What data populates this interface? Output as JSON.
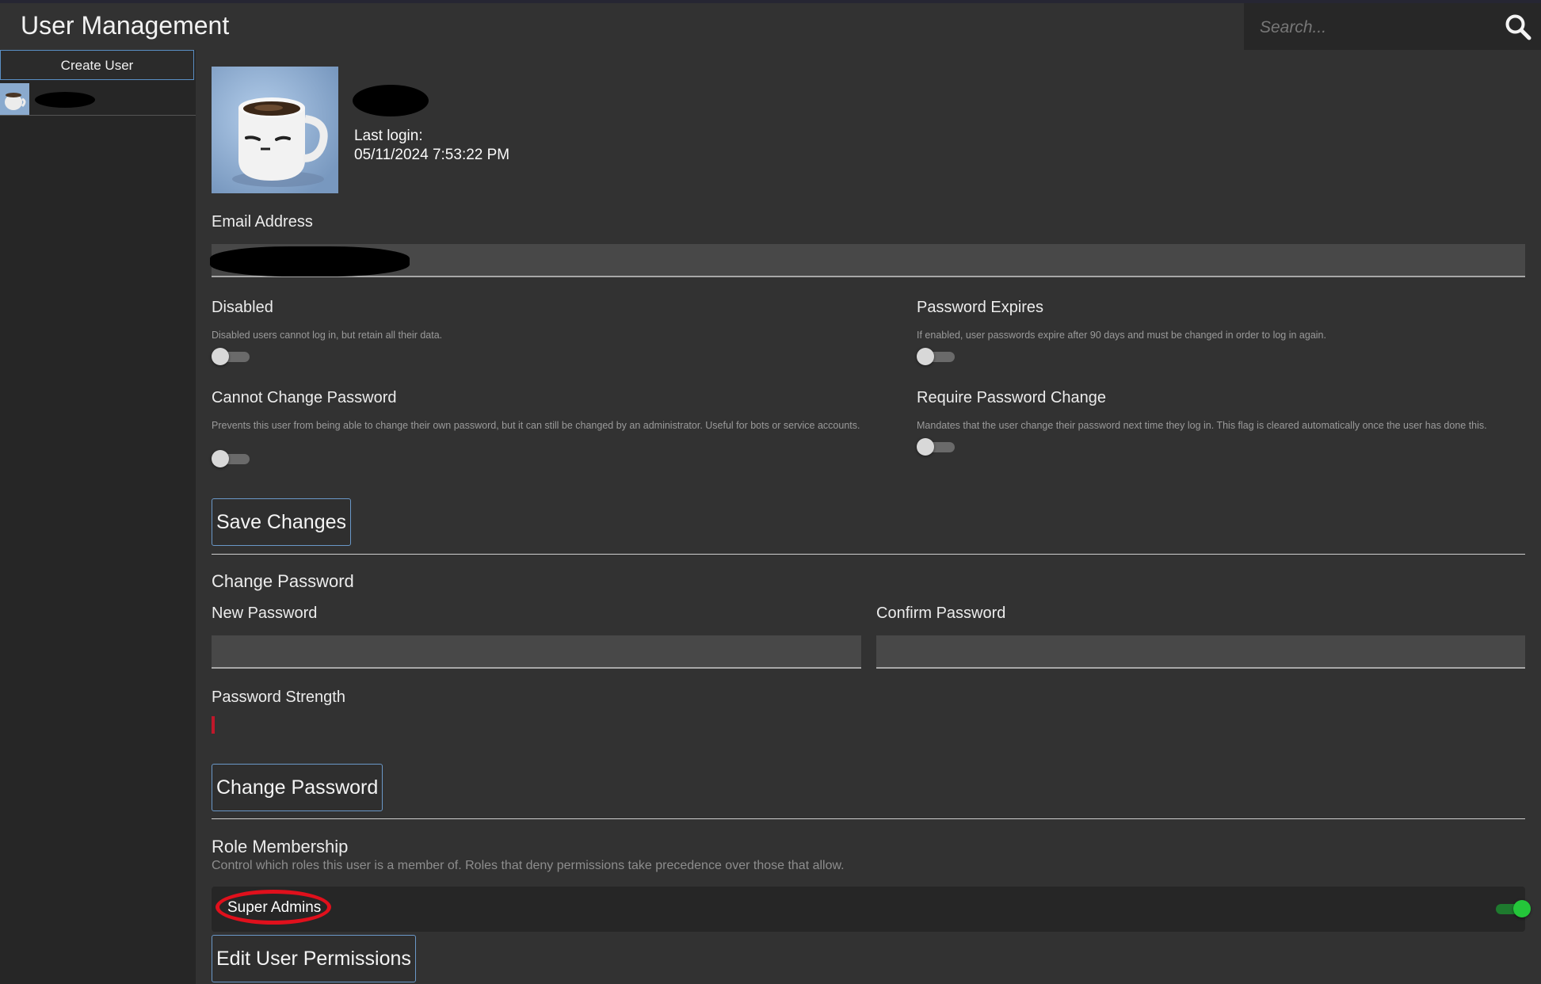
{
  "header": {
    "title": "User Management",
    "search_placeholder": "Search..."
  },
  "sidebar": {
    "create_user_label": "Create User"
  },
  "profile": {
    "last_login_label": "Last login:",
    "last_login_value": "05/11/2024 7:53:22 PM"
  },
  "account": {
    "email_label": "Email Address",
    "disabled": {
      "label": "Disabled",
      "help": "Disabled users cannot log in, but retain all their data.",
      "enabled": false
    },
    "password_expires": {
      "label": "Password Expires",
      "help": "If enabled, user passwords expire after 90 days and must be changed in order to log in again.",
      "enabled": false
    },
    "cannot_change_password": {
      "label": "Cannot Change Password",
      "help": "Prevents this user from being able to change their own password, but it can still be changed by an administrator. Useful for bots or service accounts.",
      "enabled": false
    },
    "require_password_change": {
      "label": "Require Password Change",
      "help": "Mandates that the user change their password next time they log in. This flag is cleared automatically once the user has done this.",
      "enabled": false
    },
    "save_label": "Save Changes"
  },
  "change_password": {
    "title": "Change Password",
    "new_label": "New Password",
    "confirm_label": "Confirm Password",
    "strength_label": "Password Strength",
    "strength_level": 0.0,
    "button_label": "Change Password"
  },
  "roles": {
    "title": "Role Membership",
    "help": "Control which roles this user is a member of. Roles that deny permissions take precedence over those that allow.",
    "items": [
      {
        "name": "Super Admins",
        "member": true
      }
    ],
    "edit_permissions_label": "Edit User Permissions"
  },
  "colors": {
    "accent": "#6a98c8",
    "toggle_on": "#24c63a",
    "annotation": "#e0101c",
    "strength_weak": "#c0182a"
  }
}
